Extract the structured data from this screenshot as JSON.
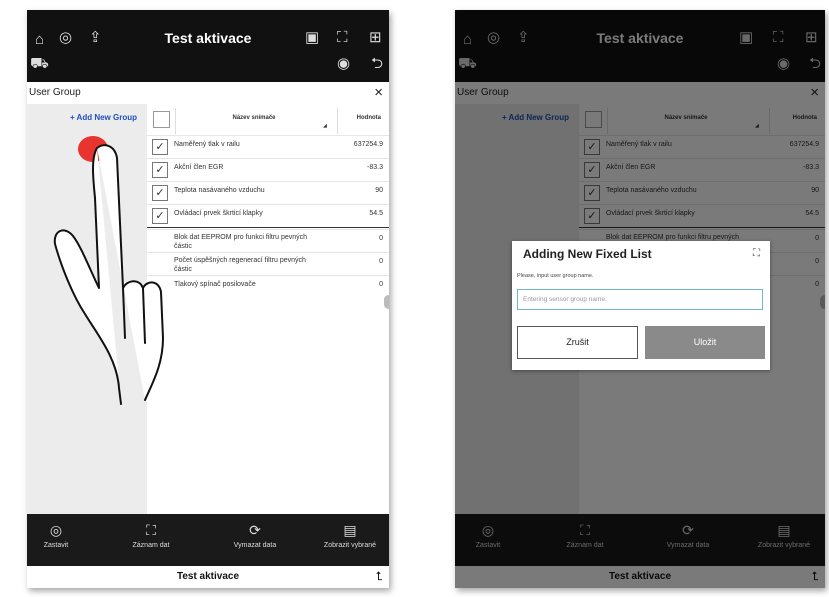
{
  "screen": {
    "title": "Test aktivace",
    "group_title": "User Group",
    "close_glyph": "×",
    "add_group_label": "+ Add New Group",
    "columns": {
      "check": "",
      "name": "Název snímače",
      "value": "Hodnota"
    },
    "rows": [
      {
        "checked": true,
        "check_mark": "✓",
        "name": "Naměřený tlak v railu",
        "value": "637254.9"
      },
      {
        "checked": true,
        "check_mark": "✓",
        "name": "Akční člen EGR",
        "value": "-83.3"
      },
      {
        "checked": true,
        "check_mark": "✓",
        "name": "Teplota nasávaného vzduchu",
        "value": "90"
      },
      {
        "checked": true,
        "check_mark": "✓",
        "name": "Ovládací prvek škrticí klapky",
        "value": "54.5"
      },
      {
        "checked": false,
        "check_mark": "",
        "name": "Blok dat EEPROM pro funkci filtru pevných částic",
        "value": "0"
      },
      {
        "checked": false,
        "check_mark": "",
        "name": "Počet úspěšných regenerací filtru pevných částic",
        "value": "0"
      },
      {
        "checked": false,
        "check_mark": "",
        "name": "Tlakový spínač posilovače",
        "value": "0"
      }
    ],
    "toolbar": [
      {
        "label": "Zastavit",
        "icon": "stop-icon",
        "glyph": "◎"
      },
      {
        "label": "Záznam dat",
        "icon": "record-data-icon",
        "glyph": "⛶"
      },
      {
        "label": "Vymazat data",
        "icon": "refresh-icon",
        "glyph": "⟳"
      },
      {
        "label": "Zobrazit vybrané",
        "icon": "show-selected-icon",
        "glyph": "▤"
      }
    ],
    "top_icons": [
      {
        "name": "home-icon",
        "glyph": "⌂"
      },
      {
        "name": "diagnostics-icon",
        "glyph": "◎"
      },
      {
        "name": "export-icon",
        "glyph": "⇪"
      },
      {
        "name": "battery-icon",
        "glyph": "▣"
      },
      {
        "name": "scan-icon",
        "glyph": "⛶"
      },
      {
        "name": "grid-icon",
        "glyph": "⊞"
      },
      {
        "name": "vehicle-icon",
        "glyph": "⛟"
      },
      {
        "name": "signal-icon",
        "glyph": "◉"
      },
      {
        "name": "exit-icon",
        "glyph": "⮌"
      }
    ],
    "footer_icon_glyph": "⮤"
  },
  "dialog": {
    "title": "Adding New Fixed List",
    "prompt": "Please, input user group name.",
    "placeholder": "Entering sensor group name.",
    "cancel_label": "Zrušit",
    "save_label": "Uložit",
    "icon_glyph": "⛶"
  },
  "colors": {
    "tap_indicator": "#e8342f",
    "link": "#1f50b8",
    "save_button": "#8a8a8a",
    "bar": "#111111"
  }
}
